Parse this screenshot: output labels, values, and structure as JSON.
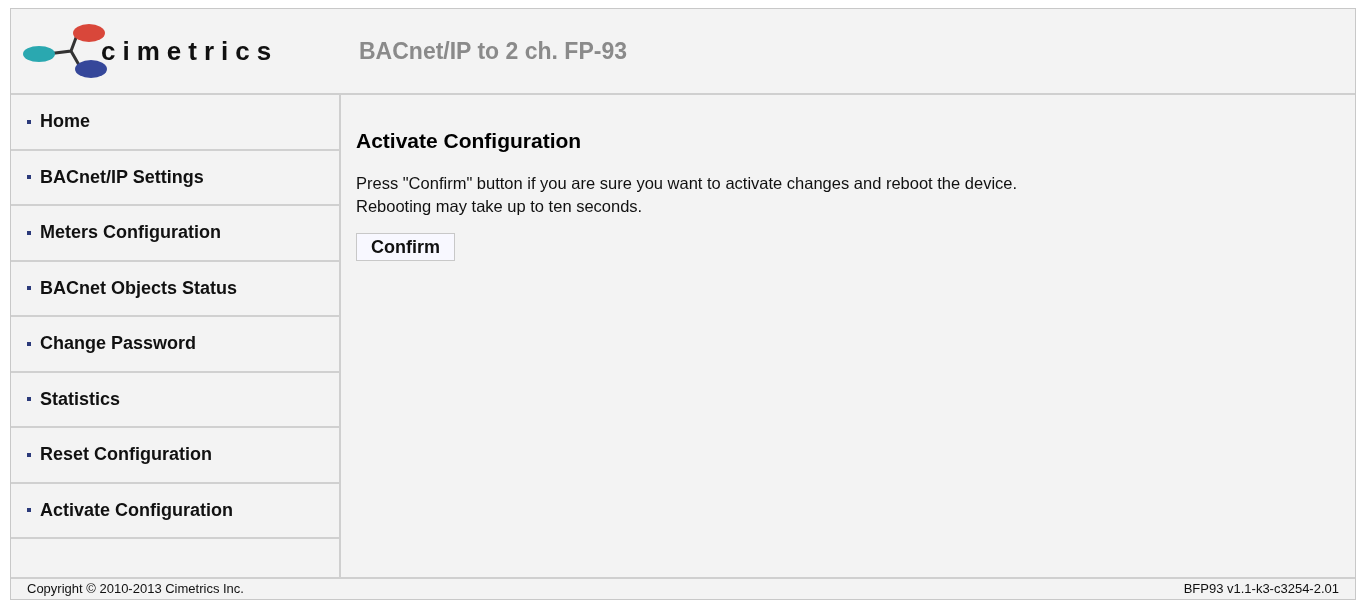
{
  "logo": {
    "wordmark": "cimetrics"
  },
  "header": {
    "title": "BACnet/IP to 2 ch. FP-93"
  },
  "sidebar": {
    "items": [
      {
        "label": "Home"
      },
      {
        "label": "BACnet/IP Settings"
      },
      {
        "label": "Meters Configuration"
      },
      {
        "label": "BACnet Objects Status"
      },
      {
        "label": "Change Password"
      },
      {
        "label": "Statistics"
      },
      {
        "label": "Reset Configuration"
      },
      {
        "label": "Activate Configuration"
      }
    ]
  },
  "content": {
    "heading": "Activate Configuration",
    "lines": [
      "Press \"Confirm\" button if you are sure you want to activate changes and reboot the device.",
      "Rebooting may take up to ten seconds."
    ],
    "button": "Confirm"
  },
  "footer": {
    "copyright": "Copyright © 2010-2013 Cimetrics Inc.",
    "version": "BFP93 v1.1-k3-c3254-2.01"
  }
}
